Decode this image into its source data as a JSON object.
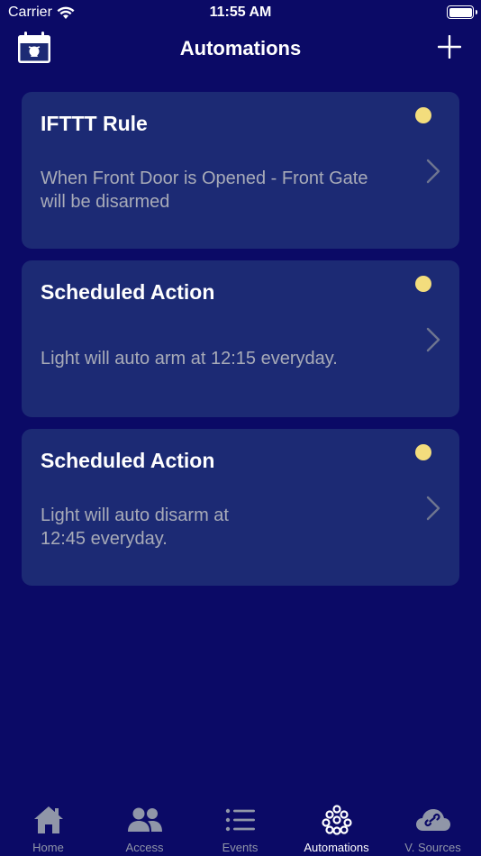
{
  "status_bar": {
    "carrier": "Carrier",
    "time": "11:55 AM"
  },
  "nav": {
    "title": "Automations"
  },
  "cards": [
    {
      "title": "IFTTT Rule",
      "description": "When Front Door is Opened - Front Gate will be disarmed",
      "status_color": "#f3dd7d"
    },
    {
      "title": "Scheduled Action",
      "description": "Light will auto arm at 12:15 everyday.",
      "status_color": "#f3dd7d"
    },
    {
      "title": "Scheduled Action",
      "description": "Light will auto disarm at 12:45 everyday.",
      "status_color": "#f3dd7d"
    }
  ],
  "tabs": [
    {
      "label": "Home",
      "icon": "home-icon"
    },
    {
      "label": "Access",
      "icon": "people-icon"
    },
    {
      "label": "Events",
      "icon": "list-icon"
    },
    {
      "label": "Automations",
      "icon": "automations-icon",
      "active": true
    },
    {
      "label": "V. Sources",
      "icon": "cloud-link-icon"
    }
  ],
  "colors": {
    "background": "#0b0a66",
    "card": "#1c2a74",
    "accent_dot": "#f3dd7d",
    "inactive_tab": "#9096a8"
  }
}
